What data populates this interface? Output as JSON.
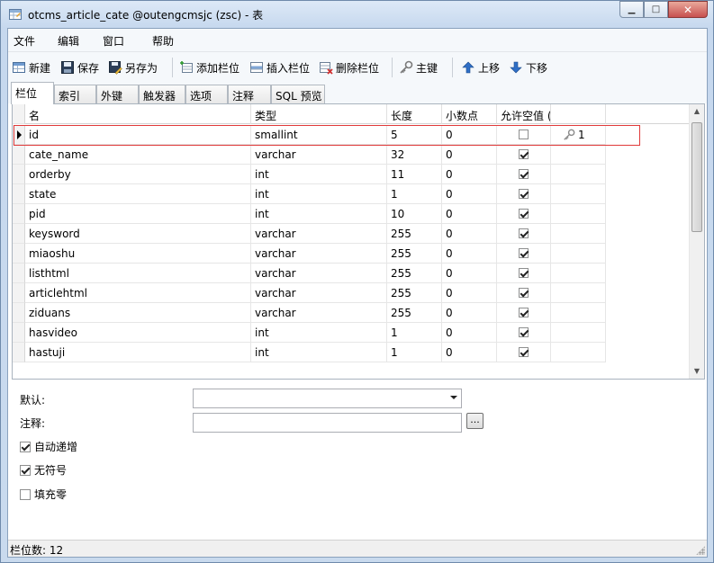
{
  "window": {
    "title": "otcms_article_cate @outengcmsjc (zsc) - 表",
    "close_glyph": "✕",
    "min_glyph": "▁",
    "max_glyph": "□"
  },
  "menu": [
    "文件",
    "编辑",
    "窗口",
    "帮助"
  ],
  "toolbar": {
    "new": "新建",
    "save": "保存",
    "save_as": "另存为",
    "add_col": "添加栏位",
    "insert_col": "插入栏位",
    "delete_col": "删除栏位",
    "primary_key": "主键",
    "move_up": "上移",
    "move_down": "下移"
  },
  "tabs": [
    "栏位",
    "索引",
    "外键",
    "触发器",
    "选项",
    "注释",
    "SQL 预览"
  ],
  "grid": {
    "headers": [
      "名",
      "类型",
      "长度",
      "小数点",
      "允许空值 (",
      ""
    ],
    "rows": [
      {
        "name": "id",
        "type": "smallint",
        "length": "5",
        "decimals": "0",
        "nullable": false,
        "key": "1"
      },
      {
        "name": "cate_name",
        "type": "varchar",
        "length": "32",
        "decimals": "0",
        "nullable": true,
        "key": ""
      },
      {
        "name": "orderby",
        "type": "int",
        "length": "11",
        "decimals": "0",
        "nullable": true,
        "key": ""
      },
      {
        "name": "state",
        "type": "int",
        "length": "1",
        "decimals": "0",
        "nullable": true,
        "key": ""
      },
      {
        "name": "pid",
        "type": "int",
        "length": "10",
        "decimals": "0",
        "nullable": true,
        "key": ""
      },
      {
        "name": "keysword",
        "type": "varchar",
        "length": "255",
        "decimals": "0",
        "nullable": true,
        "key": ""
      },
      {
        "name": "miaoshu",
        "type": "varchar",
        "length": "255",
        "decimals": "0",
        "nullable": true,
        "key": ""
      },
      {
        "name": "listhtml",
        "type": "varchar",
        "length": "255",
        "decimals": "0",
        "nullable": true,
        "key": ""
      },
      {
        "name": "articlehtml",
        "type": "varchar",
        "length": "255",
        "decimals": "0",
        "nullable": true,
        "key": ""
      },
      {
        "name": "ziduans",
        "type": "varchar",
        "length": "255",
        "decimals": "0",
        "nullable": true,
        "key": ""
      },
      {
        "name": "hasvideo",
        "type": "int",
        "length": "1",
        "decimals": "0",
        "nullable": true,
        "key": ""
      },
      {
        "name": "hastuji",
        "type": "int",
        "length": "1",
        "decimals": "0",
        "nullable": true,
        "key": ""
      }
    ]
  },
  "props": {
    "default_label": "默认:",
    "comment_label": "注释:",
    "browse_btn": "...",
    "auto_increment": "自动递增",
    "unsigned": "无符号",
    "zerofill": "填充零"
  },
  "status": {
    "field_count": "栏位数: 12"
  }
}
